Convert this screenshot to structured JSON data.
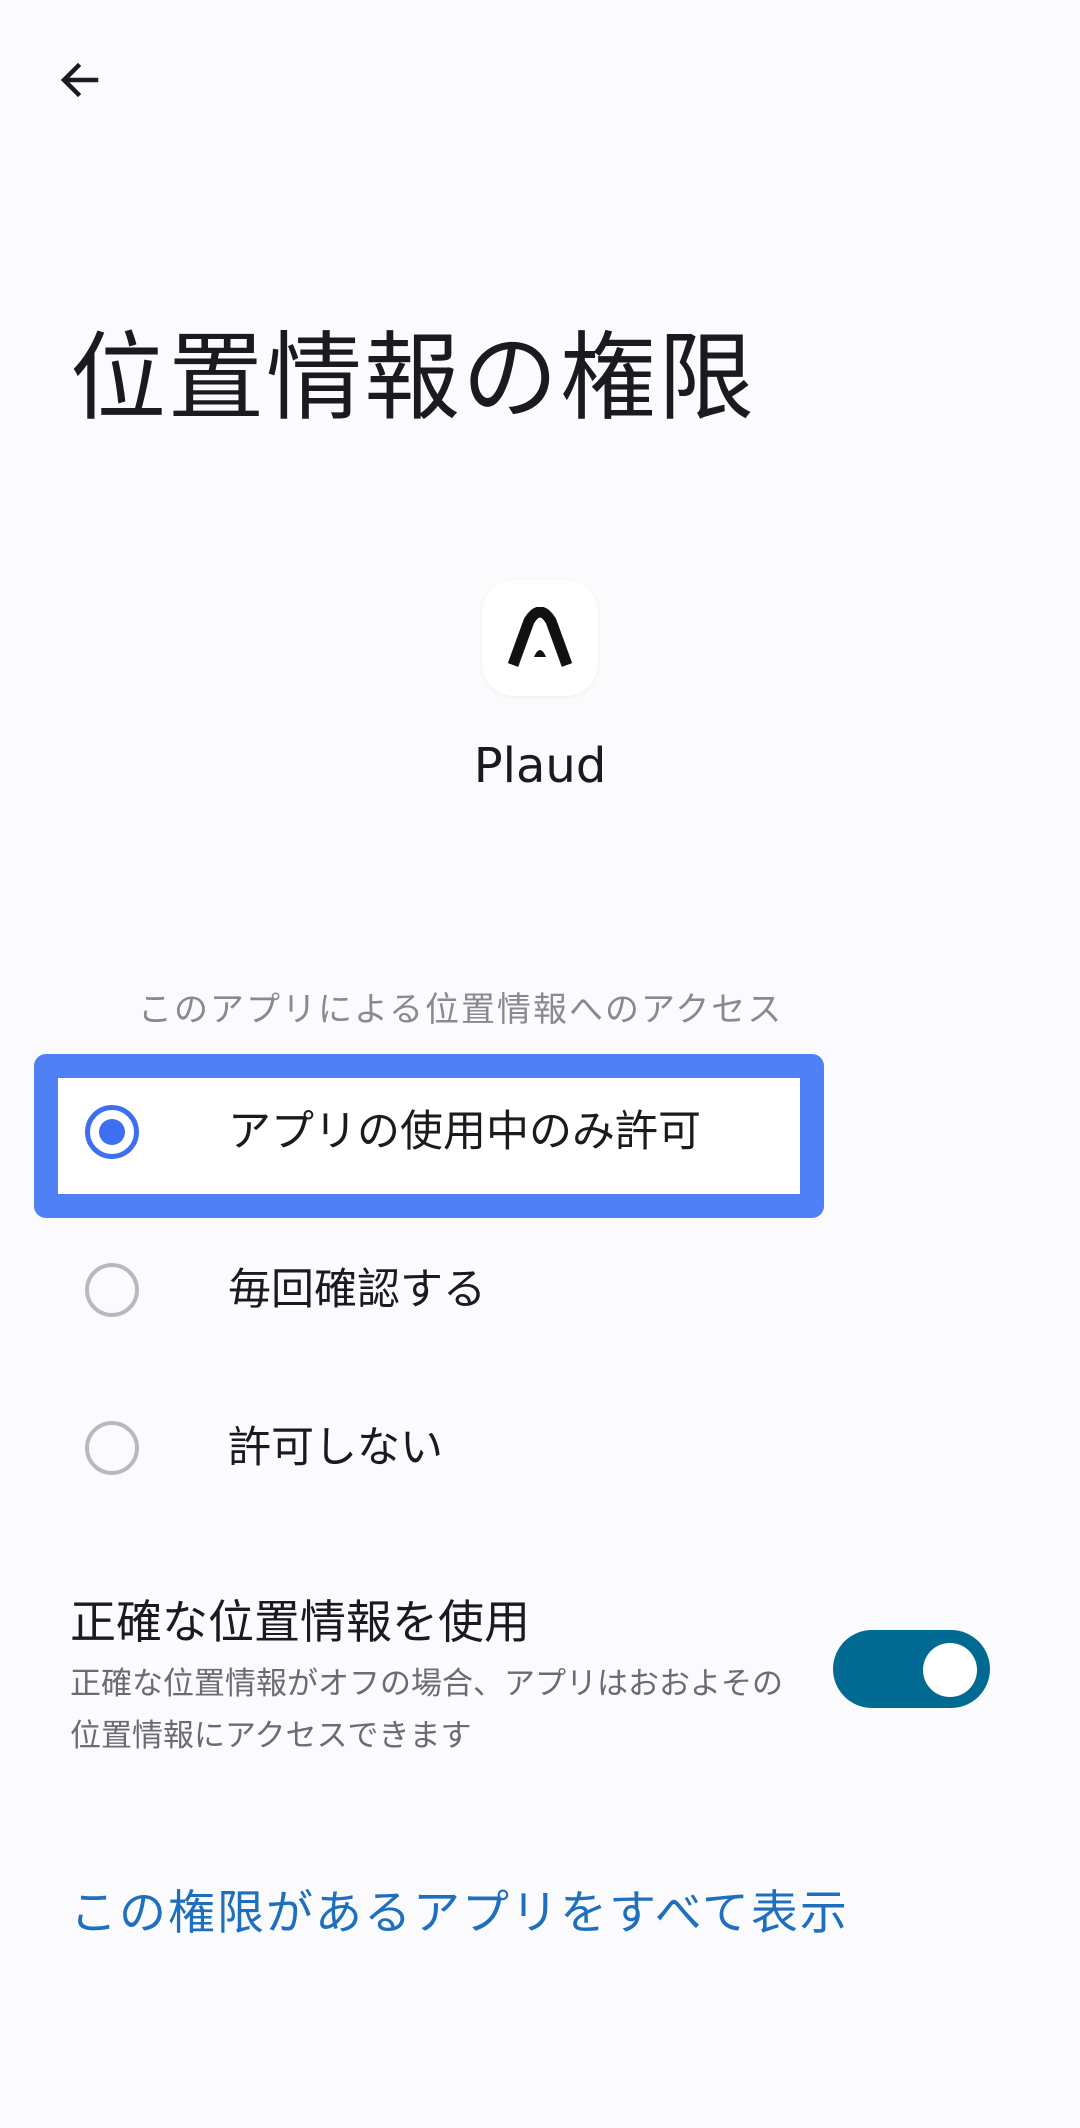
{
  "header": {
    "back_icon": "arrow-left-icon",
    "title": "位置情報の権限"
  },
  "app": {
    "icon": "plaud-logo-icon",
    "name": "Plaud"
  },
  "access_section": {
    "header": "このアプリによる位置情報へのアクセス",
    "options": [
      {
        "label": "アプリの使用中のみ許可",
        "selected": true
      },
      {
        "label": "毎回確認する",
        "selected": false
      },
      {
        "label": "許可しない",
        "selected": false
      }
    ]
  },
  "precise_location": {
    "title": "正確な位置情報を使用",
    "description": "正確な位置情報がオフの場合、アプリはおおよその位置情報にアクセスできます",
    "enabled": true
  },
  "footer": {
    "see_all_link": "この権限があるアプリをすべて表示"
  },
  "colors": {
    "highlight": "#5080f5",
    "radio_selected": "#3e6ff0",
    "toggle_on": "#006a93",
    "link": "#1f6fbf"
  }
}
